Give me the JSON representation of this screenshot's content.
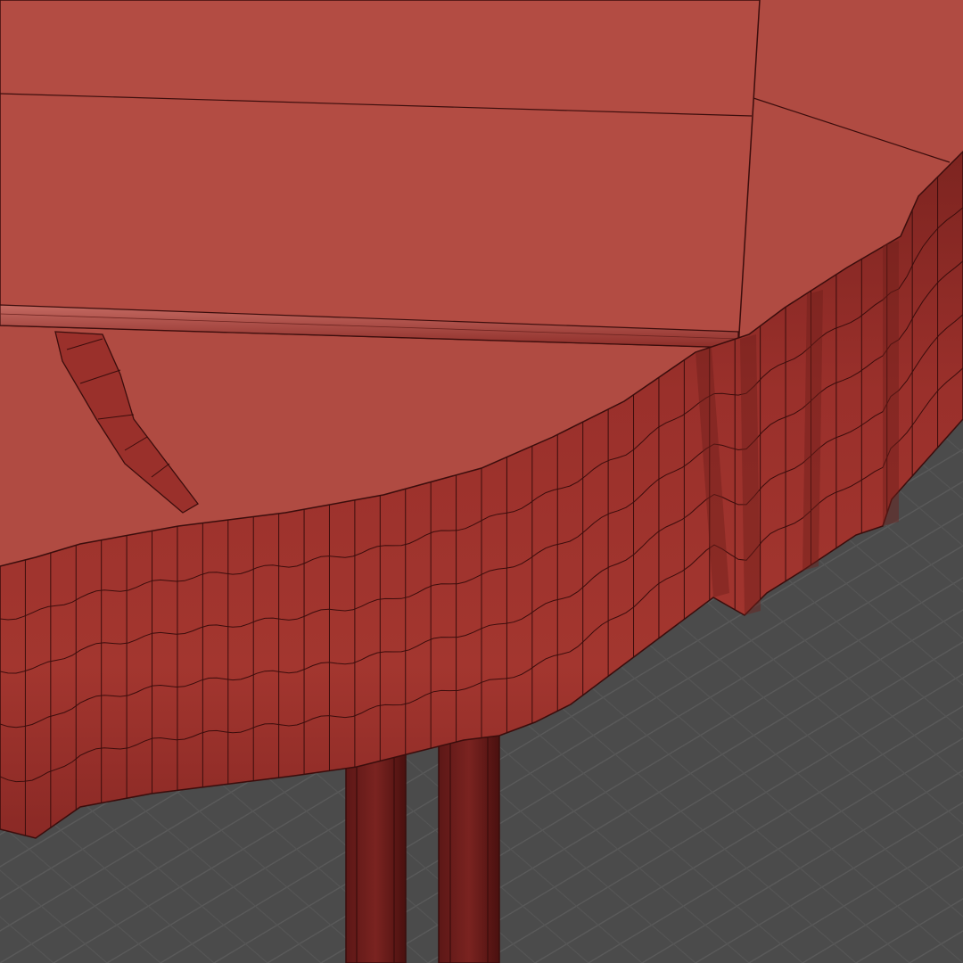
{
  "viewport": {
    "projection": "perspective",
    "shading": "flat",
    "wireframe_overlay": true,
    "grid": true
  },
  "colors": {
    "background": "#4b4b4b",
    "grid_line": "#5a5a5a",
    "grid_line_minor": "#555555",
    "top_surface": "#b04b42",
    "top_surface_light": "#b5534a",
    "edge_band_light": "#a83a33",
    "edge_band_dark": "#7d2420",
    "edge_band_shadow": "#5a1614",
    "leg": "#6e1e1b",
    "leg_dark": "#4a100f",
    "wire": "#3b0d0c"
  },
  "objects": [
    {
      "name": "table-top-slab",
      "kind": "mesh"
    },
    {
      "name": "live-edge-band",
      "kind": "mesh"
    },
    {
      "name": "table-leg-left",
      "kind": "mesh"
    },
    {
      "name": "table-leg-right",
      "kind": "mesh"
    },
    {
      "name": "crack-strip",
      "kind": "mesh"
    },
    {
      "name": "upper-box",
      "kind": "mesh"
    }
  ]
}
